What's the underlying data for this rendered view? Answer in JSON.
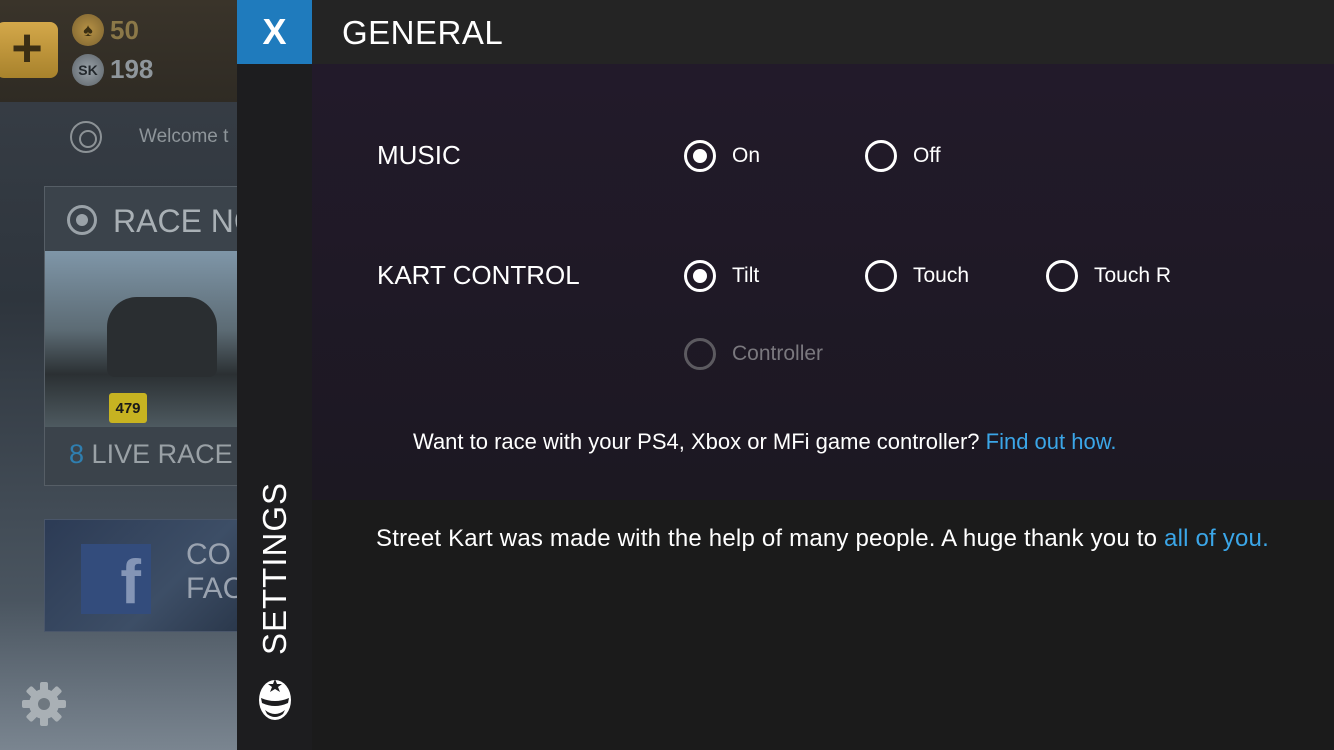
{
  "background": {
    "coins": {
      "gold": "50",
      "sk": "198",
      "sk_badge": "SK"
    },
    "welcome_text": "Welcome t",
    "race_card": {
      "title": "RACE NO",
      "plate": "479",
      "live_count": "8",
      "live_text": "LIVE RACE"
    },
    "facebook_card": {
      "line1": "CO",
      "line2": "FAC"
    }
  },
  "settings": {
    "close_label": "X",
    "side_label": "SETTINGS",
    "section_title": "GENERAL",
    "music": {
      "label": "MUSIC",
      "options": [
        {
          "label": "On",
          "selected": true
        },
        {
          "label": "Off",
          "selected": false
        }
      ]
    },
    "kart_control": {
      "label": "KART CONTROL",
      "options": [
        {
          "label": "Tilt",
          "selected": true
        },
        {
          "label": "Touch",
          "selected": false
        },
        {
          "label": "Touch R",
          "selected": false
        },
        {
          "label": "Controller",
          "selected": false,
          "disabled": true
        }
      ]
    },
    "controller_info": {
      "text": "Want to race with your PS4, Xbox or MFi game controller? ",
      "link": "Find out how."
    },
    "credits": {
      "text": "Street Kart was made with the help of many people. A huge thank you to ",
      "link": "all of you."
    }
  },
  "colors": {
    "accent": "#1f7bbd",
    "link": "#3ba6e8"
  }
}
